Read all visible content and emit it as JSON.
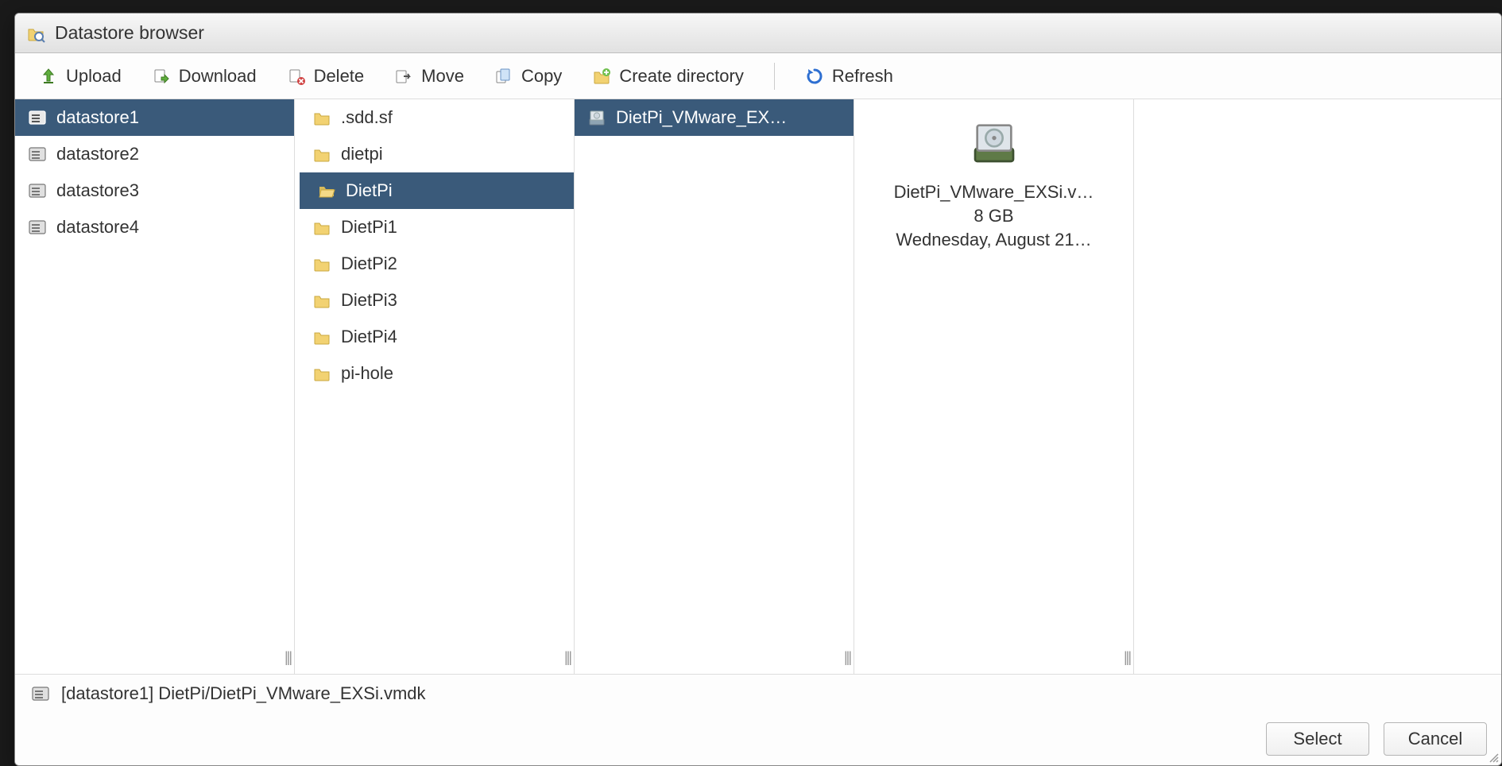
{
  "window": {
    "title": "Datastore browser"
  },
  "toolbar": {
    "upload": "Upload",
    "download": "Download",
    "delete": "Delete",
    "move": "Move",
    "copy": "Copy",
    "create_dir": "Create directory",
    "refresh": "Refresh"
  },
  "datastores": [
    {
      "label": "datastore1",
      "selected": true
    },
    {
      "label": "datastore2",
      "selected": false
    },
    {
      "label": "datastore3",
      "selected": false
    },
    {
      "label": "datastore4",
      "selected": false
    }
  ],
  "folders": [
    {
      "label": ".sdd.sf",
      "selected": false
    },
    {
      "label": "dietpi",
      "selected": false
    },
    {
      "label": "DietPi",
      "selected": true
    },
    {
      "label": "DietPi1",
      "selected": false
    },
    {
      "label": "DietPi2",
      "selected": false
    },
    {
      "label": "DietPi3",
      "selected": false
    },
    {
      "label": "DietPi4",
      "selected": false
    },
    {
      "label": "pi-hole",
      "selected": false
    }
  ],
  "files": [
    {
      "label": "DietPi_VMware_EX…",
      "selected": true
    }
  ],
  "detail": {
    "name": "DietPi_VMware_EXSi.v…",
    "size": "8 GB",
    "date": "Wednesday, August 21…"
  },
  "path": "[datastore1] DietPi/DietPi_VMware_EXSi.vmdk",
  "buttons": {
    "select": "Select",
    "cancel": "Cancel"
  }
}
